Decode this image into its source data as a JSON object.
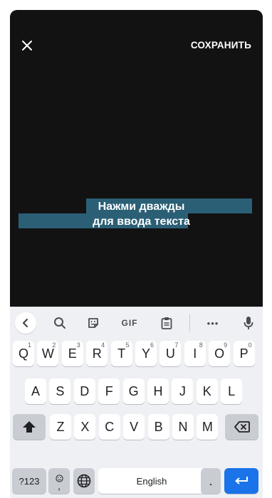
{
  "topbar": {
    "save_label": "СОХРАНИТЬ"
  },
  "editor": {
    "caption_line1": "Нажми дважды",
    "caption_line2": "для ввода текста",
    "highlight_color": "#2b5f75"
  },
  "keyboard": {
    "toolbar": [
      "back-icon",
      "search-icon",
      "sticker-icon",
      "GIF",
      "clipboard-icon",
      "more-icon",
      "mic-icon"
    ],
    "gif_label": "GIF",
    "more_label": "•••",
    "row1": [
      {
        "k": "Q",
        "h": "1"
      },
      {
        "k": "W",
        "h": "2"
      },
      {
        "k": "E",
        "h": "3"
      },
      {
        "k": "R",
        "h": "4"
      },
      {
        "k": "T",
        "h": "5"
      },
      {
        "k": "Y",
        "h": "6"
      },
      {
        "k": "U",
        "h": "7"
      },
      {
        "k": "I",
        "h": "8"
      },
      {
        "k": "O",
        "h": "9"
      },
      {
        "k": "P",
        "h": "0"
      }
    ],
    "row2": [
      "A",
      "S",
      "D",
      "F",
      "G",
      "H",
      "J",
      "K",
      "L"
    ],
    "row3": [
      "Z",
      "X",
      "C",
      "V",
      "B",
      "N",
      "M"
    ],
    "sym_label": "?123",
    "comma_label": ",",
    "space_label": "English",
    "period_label": ".",
    "accent_color": "#1a73e8"
  }
}
